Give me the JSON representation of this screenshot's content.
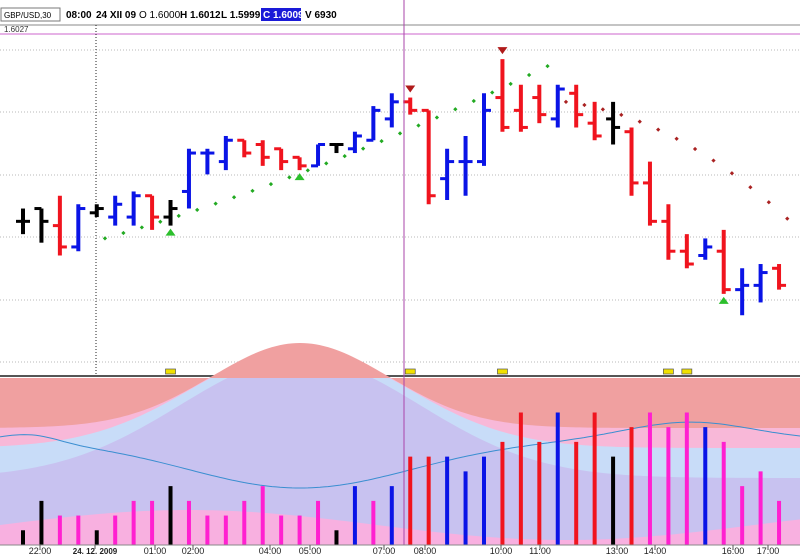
{
  "header": {
    "symbol": "GBP/USD,30",
    "time": "08:00",
    "date": "24 XII 09",
    "open": "O 1.6000",
    "high": "H 1.6012",
    "low": "L 1.5999",
    "close": "C 1.6009",
    "volume": "V 6930"
  },
  "price_scale_label": "1.6027",
  "colors": {
    "up": "#0a14e6",
    "down": "#f0141e",
    "neutral": "#000000",
    "sar_up": "#22aa22",
    "sar_down": "#aa2222",
    "crosshair": "#aa44aa",
    "marker": "#f0e000"
  },
  "chart_data": {
    "type": "ohlc",
    "x_labels": [
      "22:00",
      "24. 12. 2009",
      "01:00",
      "02:00",
      "04:00",
      "05:00",
      "07:00",
      "08:00",
      "10:00",
      "11:00",
      "13:00",
      "14:00",
      "16:00",
      "17:00"
    ],
    "price_range": [
      1.5951,
      1.6033
    ],
    "bars": [
      {
        "o": 1.5987,
        "h": 1.599,
        "l": 1.5984,
        "c": 1.5987,
        "d": "n"
      },
      {
        "o": 1.599,
        "h": 1.599,
        "l": 1.5982,
        "c": 1.5987,
        "d": "n"
      },
      {
        "o": 1.5986,
        "h": 1.5993,
        "l": 1.5979,
        "c": 1.5981,
        "d": "r"
      },
      {
        "o": 1.5981,
        "h": 1.5991,
        "l": 1.598,
        "c": 1.599,
        "d": "b"
      },
      {
        "o": 1.5989,
        "h": 1.5991,
        "l": 1.5988,
        "c": 1.599,
        "d": "n"
      },
      {
        "o": 1.5988,
        "h": 1.5993,
        "l": 1.5986,
        "c": 1.5991,
        "d": "b"
      },
      {
        "o": 1.5988,
        "h": 1.5994,
        "l": 1.5986,
        "c": 1.5993,
        "d": "b"
      },
      {
        "o": 1.5993,
        "h": 1.5993,
        "l": 1.5985,
        "c": 1.5988,
        "d": "r"
      },
      {
        "o": 1.5988,
        "h": 1.5992,
        "l": 1.5986,
        "c": 1.599,
        "d": "n"
      },
      {
        "o": 1.5994,
        "h": 1.6004,
        "l": 1.599,
        "c": 1.6003,
        "d": "b"
      },
      {
        "o": 1.6003,
        "h": 1.6004,
        "l": 1.5998,
        "c": 1.6003,
        "d": "b"
      },
      {
        "o": 1.6001,
        "h": 1.6007,
        "l": 1.5999,
        "c": 1.6006,
        "d": "b"
      },
      {
        "o": 1.6006,
        "h": 1.6006,
        "l": 1.6002,
        "c": 1.6003,
        "d": "r"
      },
      {
        "o": 1.6005,
        "h": 1.6006,
        "l": 1.6,
        "c": 1.6002,
        "d": "r"
      },
      {
        "o": 1.6004,
        "h": 1.6004,
        "l": 1.5999,
        "c": 1.6001,
        "d": "r"
      },
      {
        "o": 1.6002,
        "h": 1.6002,
        "l": 1.5999,
        "c": 1.6,
        "d": "r"
      },
      {
        "o": 1.6,
        "h": 1.6005,
        "l": 1.6,
        "c": 1.6005,
        "d": "b"
      },
      {
        "o": 1.6005,
        "h": 1.6005,
        "l": 1.6003,
        "c": 1.6005,
        "d": "n"
      },
      {
        "o": 1.6004,
        "h": 1.6008,
        "l": 1.6003,
        "c": 1.6007,
        "d": "b"
      },
      {
        "o": 1.6006,
        "h": 1.6014,
        "l": 1.6006,
        "c": 1.6013,
        "d": "b"
      },
      {
        "o": 1.6011,
        "h": 1.6017,
        "l": 1.6009,
        "c": 1.6015,
        "d": "b"
      },
      {
        "o": 1.6015,
        "h": 1.6016,
        "l": 1.6012,
        "c": 1.6013,
        "d": "r"
      },
      {
        "o": 1.6013,
        "h": 1.6013,
        "l": 1.5991,
        "c": 1.5993,
        "d": "r"
      },
      {
        "o": 1.5997,
        "h": 1.6004,
        "l": 1.5992,
        "c": 1.6001,
        "d": "b"
      },
      {
        "o": 1.6001,
        "h": 1.6007,
        "l": 1.5993,
        "c": 1.6001,
        "d": "b"
      },
      {
        "o": 1.6001,
        "h": 1.6017,
        "l": 1.6,
        "c": 1.6013,
        "d": "b"
      },
      {
        "o": 1.6016,
        "h": 1.6025,
        "l": 1.6008,
        "c": 1.6009,
        "d": "r"
      },
      {
        "o": 1.6013,
        "h": 1.6019,
        "l": 1.6008,
        "c": 1.6009,
        "d": "r"
      },
      {
        "o": 1.6016,
        "h": 1.6019,
        "l": 1.601,
        "c": 1.6012,
        "d": "r"
      },
      {
        "o": 1.6011,
        "h": 1.6019,
        "l": 1.6009,
        "c": 1.6018,
        "d": "b"
      },
      {
        "o": 1.6017,
        "h": 1.6019,
        "l": 1.6009,
        "c": 1.6012,
        "d": "r"
      },
      {
        "o": 1.601,
        "h": 1.6015,
        "l": 1.6006,
        "c": 1.6007,
        "d": "r"
      },
      {
        "o": 1.6011,
        "h": 1.6015,
        "l": 1.6005,
        "c": 1.6009,
        "d": "n"
      },
      {
        "o": 1.6008,
        "h": 1.6009,
        "l": 1.5993,
        "c": 1.5996,
        "d": "r"
      },
      {
        "o": 1.5996,
        "h": 1.6001,
        "l": 1.5986,
        "c": 1.5987,
        "d": "r"
      },
      {
        "o": 1.5987,
        "h": 1.5991,
        "l": 1.5978,
        "c": 1.598,
        "d": "r"
      },
      {
        "o": 1.598,
        "h": 1.5984,
        "l": 1.5976,
        "c": 1.5977,
        "d": "r"
      },
      {
        "o": 1.5979,
        "h": 1.5983,
        "l": 1.5978,
        "c": 1.5981,
        "d": "b"
      },
      {
        "o": 1.598,
        "h": 1.5985,
        "l": 1.597,
        "c": 1.5971,
        "d": "r"
      },
      {
        "o": 1.5971,
        "h": 1.5976,
        "l": 1.5965,
        "c": 1.5972,
        "d": "b"
      },
      {
        "o": 1.5972,
        "h": 1.5977,
        "l": 1.5968,
        "c": 1.5975,
        "d": "b"
      },
      {
        "o": 1.5976,
        "h": 1.5977,
        "l": 1.5971,
        "c": 1.5972,
        "d": "r"
      }
    ],
    "indicator": {
      "volumes": [
        1,
        3,
        2,
        2,
        1,
        2,
        3,
        3,
        4,
        3,
        2,
        2,
        3,
        4,
        2,
        2,
        3,
        1,
        4,
        3,
        4,
        6,
        6,
        6,
        5,
        6,
        7,
        9,
        7,
        9,
        7,
        9,
        6,
        8,
        9,
        8,
        9,
        8,
        7,
        4,
        5,
        3
      ],
      "volume_range": [
        0,
        11
      ]
    }
  }
}
